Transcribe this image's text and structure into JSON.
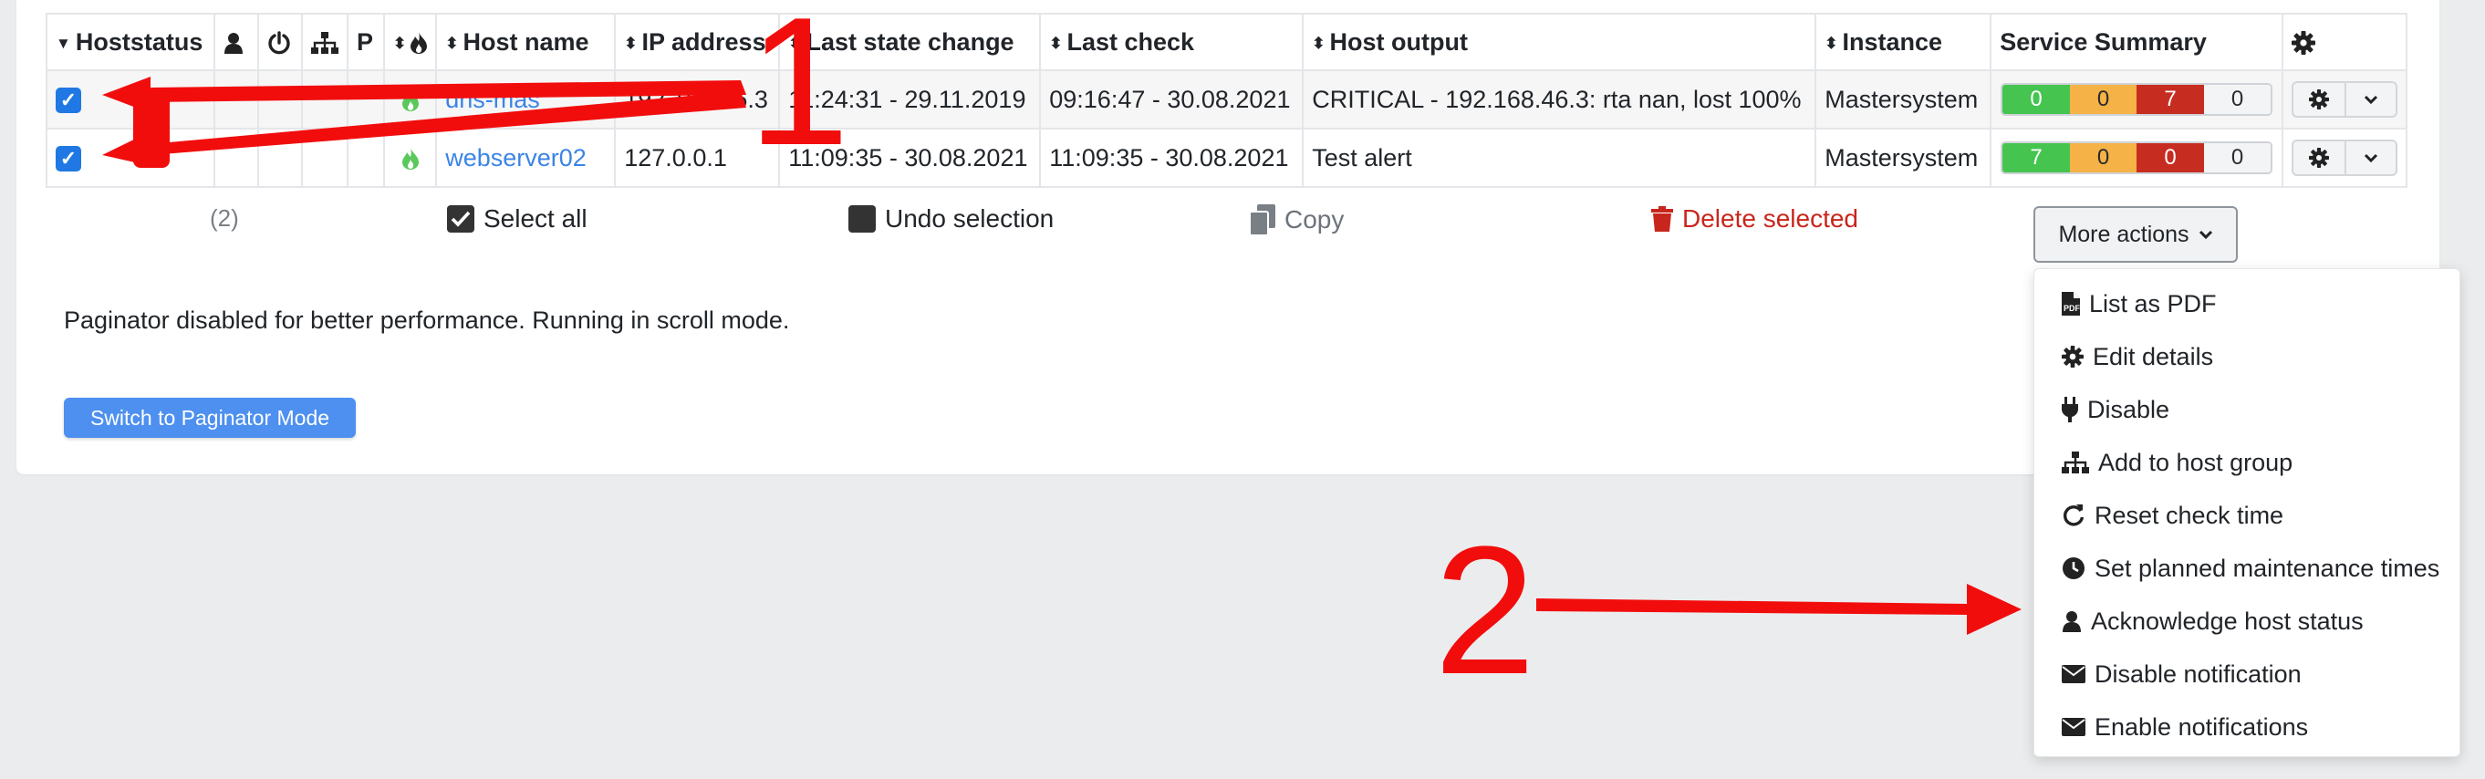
{
  "table": {
    "headers": {
      "hoststatus": "Hoststatus",
      "p": "P",
      "host_name": "Host name",
      "ip_address": "IP address",
      "last_state_change": "Last state change",
      "last_check": "Last check",
      "host_output": "Host output",
      "instance": "Instance",
      "service_summary": "Service Summary"
    },
    "rows": [
      {
        "host_name": "dns-mas",
        "ip": "192.168.46.3",
        "last_state_change": "11:24:31 - 29.11.2019",
        "last_check": "09:16:47 - 30.08.2021",
        "output": "CRITICAL - 192.168.46.3: rta nan, lost 100%",
        "instance": "Mastersystem",
        "summary": [
          "0",
          "0",
          "7",
          "0"
        ]
      },
      {
        "host_name": "webserver02",
        "ip": "127.0.0.1",
        "last_state_change": "11:09:35 - 30.08.2021",
        "last_check": "11:09:35 - 30.08.2021",
        "output": "Test alert",
        "instance": "Mastersystem",
        "summary": [
          "7",
          "0",
          "0",
          "0"
        ]
      }
    ]
  },
  "actions": {
    "count": "(2)",
    "select_all": "Select all",
    "undo_selection": "Undo selection",
    "copy": "Copy",
    "delete_selected": "Delete selected",
    "more_actions": "More actions"
  },
  "paginator": {
    "text": "Paginator disabled for better performance. Running in scroll mode.",
    "button": "Switch to Paginator Mode"
  },
  "menu": [
    {
      "label": "List as PDF",
      "icon": "file-pdf-icon"
    },
    {
      "label": "Edit details",
      "icon": "gear-icon"
    },
    {
      "label": "Disable",
      "icon": "plug-icon"
    },
    {
      "label": "Add to host group",
      "icon": "sitemap-icon"
    },
    {
      "label": "Reset check time",
      "icon": "refresh-icon"
    },
    {
      "label": "Set planned maintenance times",
      "icon": "clock-icon"
    },
    {
      "label": "Acknowledge host status",
      "icon": "user-icon"
    },
    {
      "label": "Disable notification",
      "icon": "envelope-icon"
    },
    {
      "label": "Enable notifications",
      "icon": "envelope-icon"
    }
  ],
  "annotations": {
    "one": "1",
    "two": "2"
  },
  "colors": {
    "accent": "#1f78e3",
    "link": "#3b84e6",
    "ok": "#45c450",
    "warning": "#f5b246",
    "critical": "#c72c21",
    "delete": "#c8261c",
    "annotation": "#f20d0d"
  }
}
